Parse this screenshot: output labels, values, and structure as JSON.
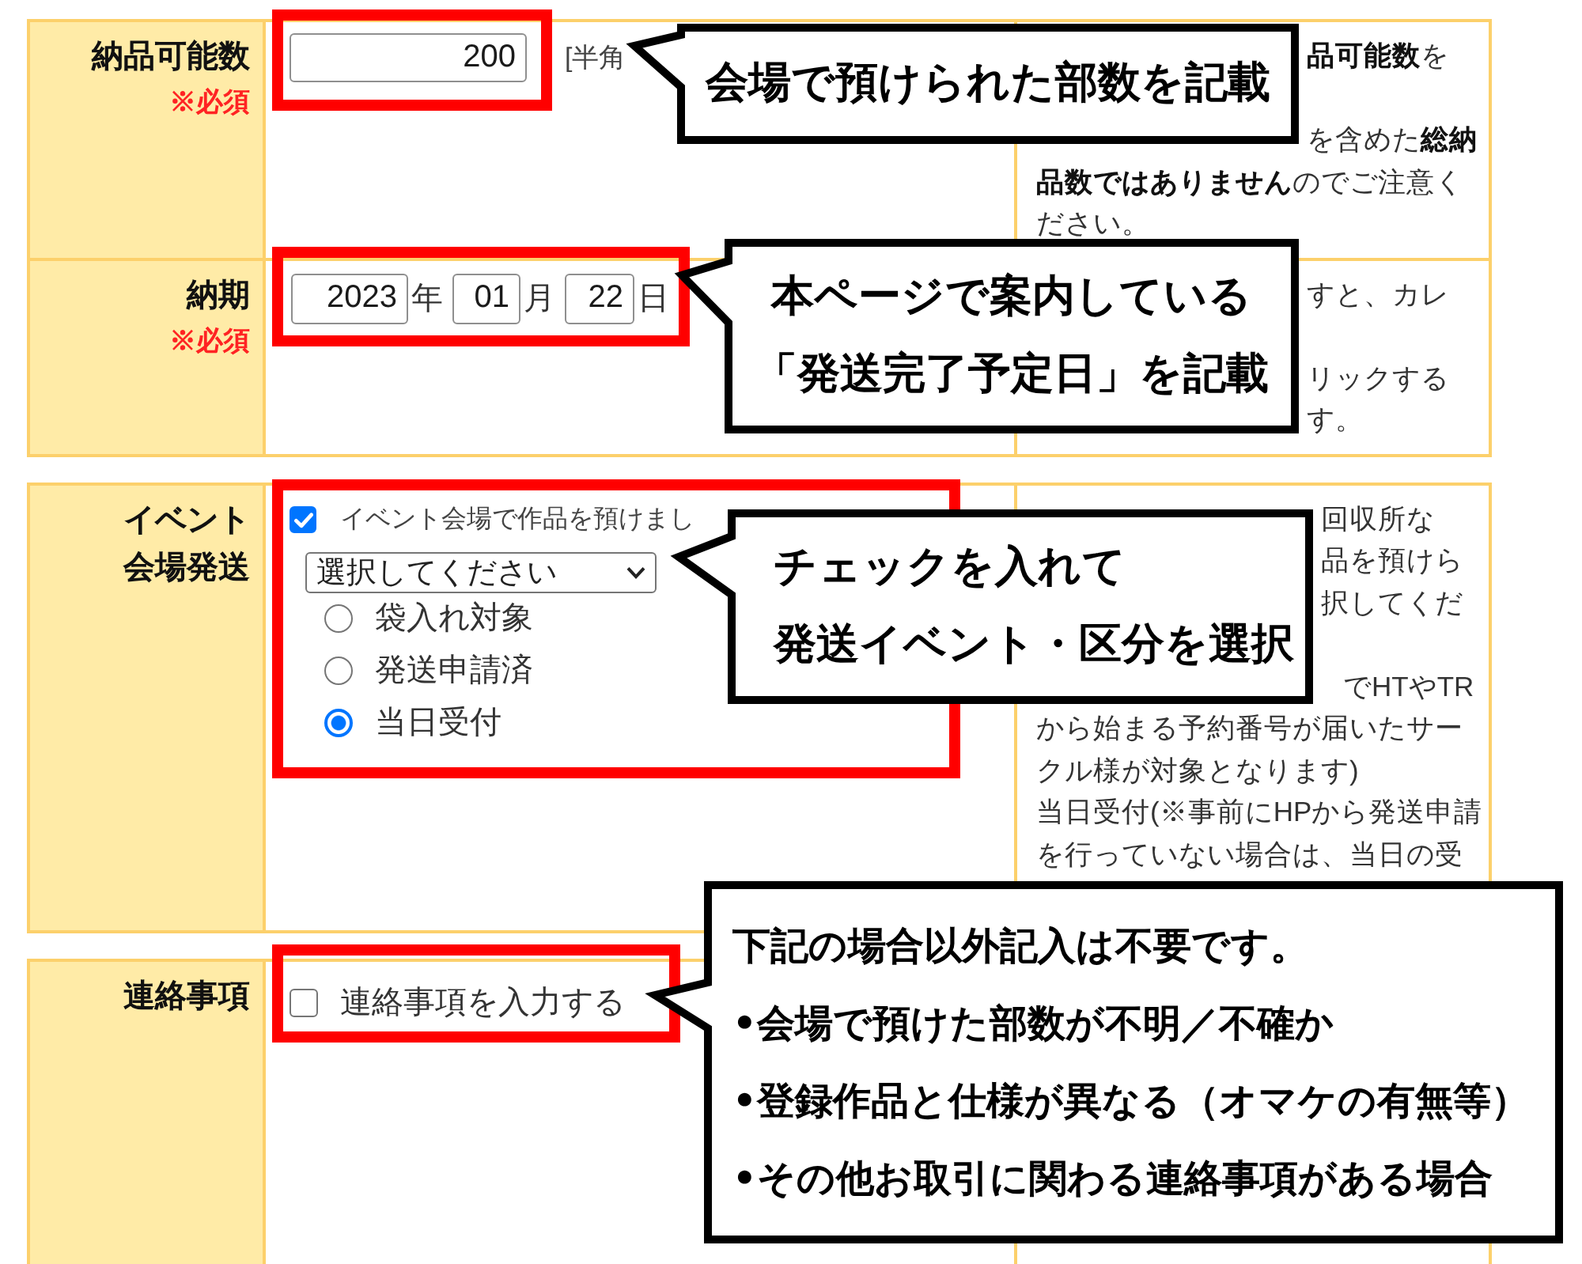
{
  "sections": [
    {
      "rows": [
        {
          "kind": "number",
          "label": "納品可能数",
          "required_note": "※必須",
          "value": "200",
          "hint": "[半角",
          "notes": [
            "**品可能数**を",
            "を含めた**総納**",
            "**品数ではありません**のでご注意く",
            "ださい。"
          ]
        },
        {
          "kind": "date",
          "label": "納期",
          "required_note": "※必須",
          "date_parts": [
            {
              "value": "2023",
              "unit": "年"
            },
            {
              "value": "01",
              "unit": "月"
            },
            {
              "value": "22",
              "unit": "日"
            }
          ],
          "notes": [
            "すと、カレ",
            "リックする",
            "す。"
          ]
        }
      ]
    },
    {
      "rows": [
        {
          "kind": "event",
          "label": "イベント会場発送",
          "checkbox": {
            "label": "イベント会場で作品を預けまし",
            "checked": true
          },
          "select": {
            "value": "選択してください"
          },
          "options": [
            {
              "label": "袋入れ対象",
              "selected": false
            },
            {
              "label": "発送申請済",
              "selected": false
            },
            {
              "label": "当日受付",
              "selected": true
            }
          ],
          "notes": [
            "回収所な",
            "品を預けら",
            "択してくだ",
            "でHTやTR",
            "から始まる予約番号が届いたサー",
            "クル様が対象となります)",
            "当日受付(※事前にHPから発送申請",
            "を行っていない場合は、当日の受"
          ]
        }
      ]
    },
    {
      "rows": [
        {
          "kind": "contact",
          "label": "連絡事項",
          "checkbox": {
            "label": "連絡事項を入力する",
            "checked": false
          }
        }
      ]
    }
  ],
  "callouts": [
    {
      "lines": [
        "会場で預けられた部数を記載"
      ]
    },
    {
      "lines": [
        "本ページで案内している",
        "「発送完了予定日」を記載"
      ]
    },
    {
      "lines": [
        "チェックを入れて",
        "発送イベント・区分を選択"
      ]
    },
    {
      "lines": [
        "下記の場合以外記入は不要です。",
        "•会場で預けた部数が不明／不確か",
        "•登録作品と仕様が異なる（オマケの有無等）",
        "•その他お取引に関わる連絡事項がある場合"
      ]
    }
  ]
}
